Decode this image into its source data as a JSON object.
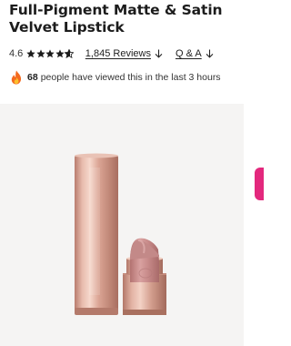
{
  "product": {
    "title": "Full-Pigment Matte & Satin Velvet Lipstick"
  },
  "rating": {
    "value": "4.6",
    "stars": 4.6,
    "reviews_label": "1,845 Reviews",
    "qa_label": "Q & A"
  },
  "social_proof": {
    "count": "68",
    "text": "people have viewed this in the last 3 hours"
  },
  "icons": {
    "star": "star-icon",
    "arrow": "arrow-down-icon",
    "fire": "fire-icon"
  },
  "colors": {
    "star": "#1a1a1a",
    "accent_tab": "#e3287d",
    "panel_bg": "#f5f4f3",
    "lipstick_bullet": "#c88a8a",
    "tube_rose_gold": "#d9a595"
  }
}
